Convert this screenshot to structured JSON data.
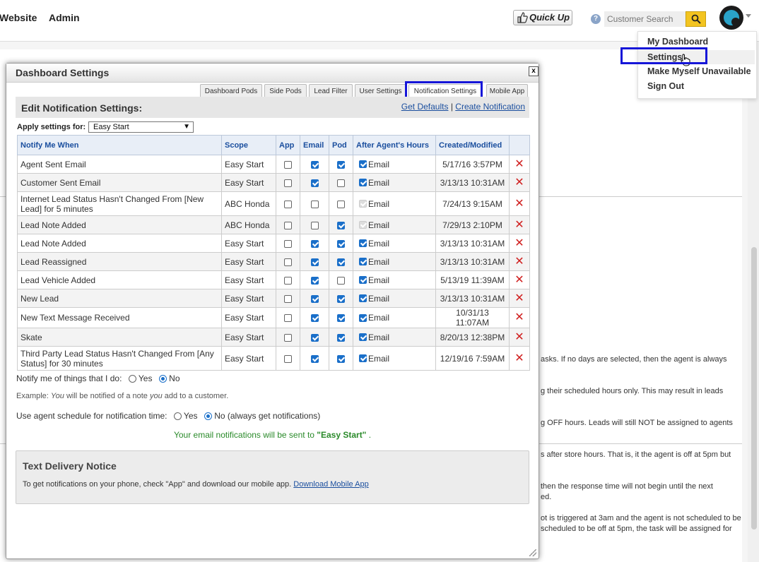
{
  "nav": {
    "website": "Website",
    "admin": "Admin",
    "quick_up": "Quick Up",
    "search_placeholder": "Customer Search"
  },
  "user_menu": {
    "items": [
      "My Dashboard",
      "Settings",
      "Make Myself Unavailable",
      "Sign Out"
    ]
  },
  "background_text": [
    "asks. If no days are selected, then the agent is always",
    "g their scheduled hours only. This may result in leads",
    "g OFF hours. Leads will still NOT be assigned to agents",
    "s after store hours. That is, it the agent is off at 5pm but",
    "then the response time will not begin until the next",
    "ed.",
    "ot is triggered at 3am and the agent is not scheduled to be",
    "scheduled to be off at 5pm, the task will be assigned for"
  ],
  "dialog": {
    "title": "Dashboard Settings",
    "close": "x",
    "tabs": [
      "Dashboard Pods",
      "Side Pods",
      "Lead Filter",
      "User Settings",
      "Notification Settings",
      "Mobile App"
    ],
    "active_tab": "Notification Settings",
    "edit_title": "Edit Notification Settings:",
    "get_defaults": "Get Defaults",
    "separator": "|",
    "create_notification": "Create Notification",
    "apply_label": "Apply settings for:",
    "apply_value": "Easy Start",
    "columns": [
      "Notify Me When",
      "Scope",
      "App",
      "Email",
      "Pod",
      "After Agent's Hours",
      "Created/Modified",
      ""
    ],
    "after_hours_label": "Email",
    "rows": [
      {
        "name": "Agent Sent Email",
        "scope": "Easy Start",
        "app": false,
        "email": true,
        "pod": true,
        "after": "on",
        "date": "5/17/16 3:57PM"
      },
      {
        "name": "Customer Sent Email",
        "scope": "Easy Start",
        "app": false,
        "email": true,
        "pod": false,
        "after": "on",
        "date": "3/13/13 10:31AM"
      },
      {
        "name": "Internet Lead Status Hasn't Changed From [New Lead] for 5 minutes",
        "scope": "ABC Honda",
        "app": false,
        "email": false,
        "pod": false,
        "after": "disabled",
        "date": "7/24/13 9:15AM"
      },
      {
        "name": "Lead Note Added",
        "scope": "ABC Honda",
        "app": false,
        "email": false,
        "pod": true,
        "after": "disabled",
        "date": "7/29/13 2:10PM"
      },
      {
        "name": "Lead Note Added",
        "scope": "Easy Start",
        "app": false,
        "email": true,
        "pod": true,
        "after": "on",
        "date": "3/13/13 10:31AM"
      },
      {
        "name": "Lead Reassigned",
        "scope": "Easy Start",
        "app": false,
        "email": true,
        "pod": true,
        "after": "on",
        "date": "3/13/13 10:31AM"
      },
      {
        "name": "Lead Vehicle Added",
        "scope": "Easy Start",
        "app": false,
        "email": true,
        "pod": false,
        "after": "on",
        "date": "5/13/19 11:39AM"
      },
      {
        "name": "New Lead",
        "scope": "Easy Start",
        "app": false,
        "email": true,
        "pod": true,
        "after": "on",
        "date": "3/13/13 10:31AM"
      },
      {
        "name": "New Text Message Received",
        "scope": "Easy Start",
        "app": false,
        "email": true,
        "pod": true,
        "after": "on",
        "date": "10/31/13 11:07AM"
      },
      {
        "name": "Skate",
        "scope": "Easy Start",
        "app": false,
        "email": true,
        "pod": true,
        "after": "on",
        "date": "8/20/13 12:38PM"
      },
      {
        "name": "Third Party Lead Status Hasn't Changed From [Any Status] for 30 minutes",
        "scope": "Easy Start",
        "app": false,
        "email": true,
        "pod": true,
        "after": "on",
        "date": "12/19/16 7:59AM"
      }
    ],
    "notify_self": {
      "label": "Notify me of things that I do:",
      "yes": "Yes",
      "no": "No",
      "selected": "No"
    },
    "example": {
      "prefix": "Example: ",
      "you1": "You",
      "middle": " will be notified of a note ",
      "you2": "you",
      "suffix": " add to a customer."
    },
    "schedule": {
      "label": "Use agent schedule for notification time:",
      "yes": "Yes",
      "no": "No (always get notifications)",
      "selected": "No"
    },
    "sent_prefix": "Your email notifications will be sent to ",
    "sent_name": "\"Easy Start\"",
    "sent_suffix": " .",
    "notice": {
      "title": "Text Delivery Notice",
      "text": "To get notifications on your phone, check \"App\" and download our mobile app. ",
      "link": "Download Mobile App"
    }
  }
}
